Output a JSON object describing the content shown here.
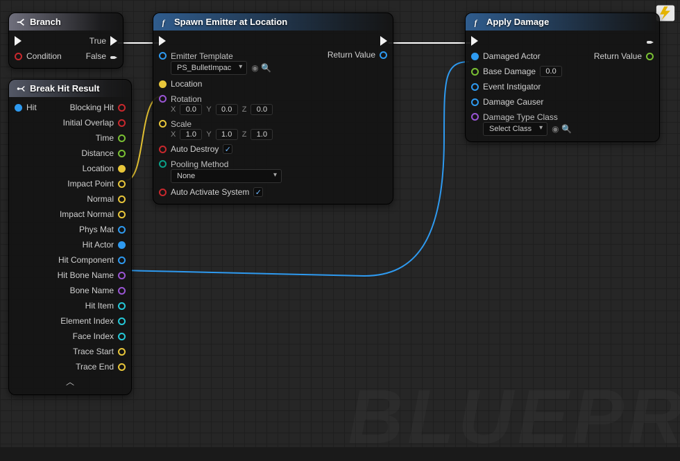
{
  "watermark": "BLUEPR",
  "corner_icon_name": "blueprint-bolt-icon",
  "nodes": {
    "branch": {
      "title": "Branch",
      "outputs": {
        "true": "True",
        "false": "False"
      },
      "inputs": {
        "condition": "Condition"
      }
    },
    "break_hit": {
      "title": "Break Hit Result",
      "input": {
        "hit": "Hit"
      },
      "outputs": {
        "blocking_hit": "Blocking Hit",
        "initial_overlap": "Initial Overlap",
        "time": "Time",
        "distance": "Distance",
        "location": "Location",
        "impact_point": "Impact Point",
        "normal": "Normal",
        "impact_normal": "Impact Normal",
        "phys_mat": "Phys Mat",
        "hit_actor": "Hit Actor",
        "hit_component": "Hit Component",
        "hit_bone_name": "Hit Bone Name",
        "bone_name": "Bone Name",
        "hit_item": "Hit Item",
        "element_index": "Element Index",
        "face_index": "Face Index",
        "trace_start": "Trace Start",
        "trace_end": "Trace End"
      }
    },
    "spawn_emitter": {
      "title": "Spawn Emitter at Location",
      "return_value": "Return Value",
      "emitter_template": {
        "label": "Emitter Template",
        "value": "PS_BulletImpac"
      },
      "location": "Location",
      "rotation": {
        "label": "Rotation",
        "x": "0.0",
        "y": "0.0",
        "z": "0.0"
      },
      "scale": {
        "label": "Scale",
        "x": "1.0",
        "y": "1.0",
        "z": "1.0"
      },
      "auto_destroy": {
        "label": "Auto Destroy",
        "checked": true
      },
      "pooling": {
        "label": "Pooling Method",
        "value": "None"
      },
      "auto_activate": {
        "label": "Auto Activate System",
        "checked": true
      }
    },
    "apply_damage": {
      "title": "Apply Damage",
      "return_value": "Return Value",
      "damaged_actor": "Damaged Actor",
      "base_damage": {
        "label": "Base Damage",
        "value": "0.0"
      },
      "event_instigator": "Event Instigator",
      "damage_causer": "Damage Causer",
      "damage_type_class": {
        "label": "Damage Type Class",
        "value": "Select Class"
      }
    }
  }
}
